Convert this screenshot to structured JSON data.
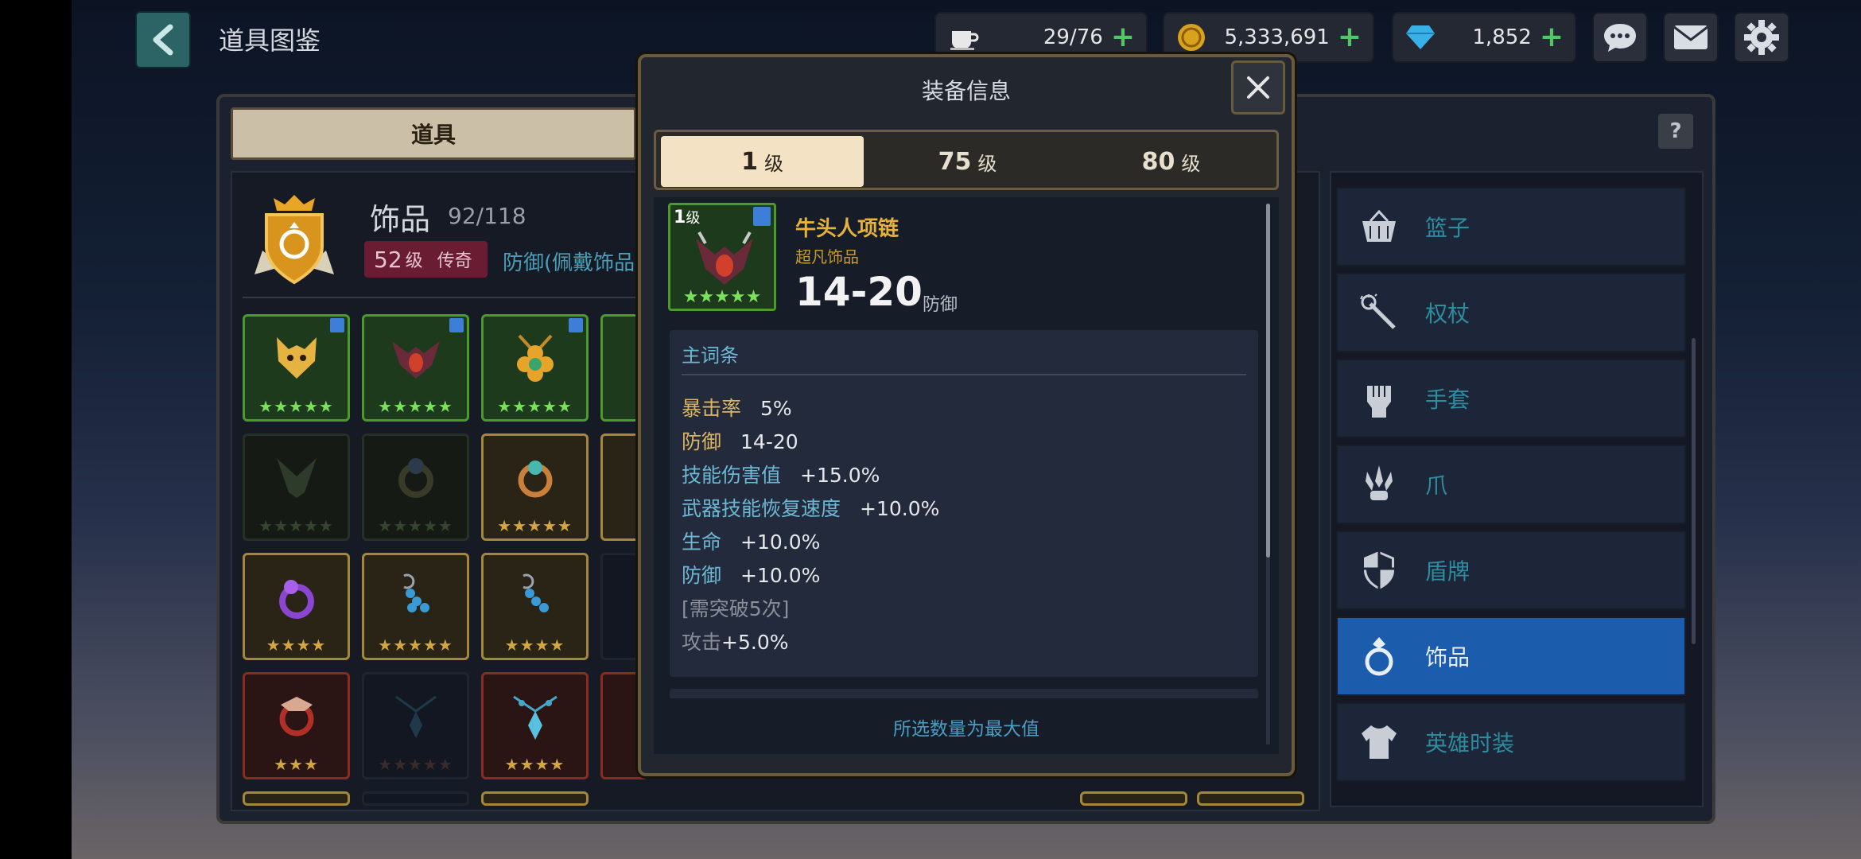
{
  "header": {
    "title": "道具图鉴",
    "stamina": "29/76",
    "gold": "5,333,691",
    "gems": "1,852"
  },
  "left_panel": {
    "tab_label": "道具",
    "category": {
      "name": "饰品",
      "count": "92/118",
      "level_value": "52",
      "level_unit": "级",
      "rank": "传奇",
      "desc": "防御(佩戴饰品"
    },
    "grid_star_rows": [
      "★★★★★",
      "★★★★★",
      "★★★★",
      "★★★"
    ]
  },
  "right_panel": {
    "help_label": "?",
    "categories": [
      {
        "label": "篮子",
        "icon": "basket-icon"
      },
      {
        "label": "权杖",
        "icon": "staff-icon"
      },
      {
        "label": "手套",
        "icon": "glove-icon"
      },
      {
        "label": "爪",
        "icon": "claw-icon"
      },
      {
        "label": "盾牌",
        "icon": "shield-icon"
      },
      {
        "label": "饰品",
        "icon": "ring-icon",
        "active": true
      },
      {
        "label": "英雄时装",
        "icon": "costume-icon"
      }
    ]
  },
  "modal": {
    "title": "装备信息",
    "tabs": [
      {
        "value": "1",
        "unit": "级",
        "active": true
      },
      {
        "value": "75",
        "unit": "级"
      },
      {
        "value": "80",
        "unit": "级"
      }
    ],
    "item": {
      "level_value": "1",
      "level_unit": "级",
      "stars": "★★★★★",
      "name": "牛头人项链",
      "rarity": "超凡饰品",
      "range": "14-20",
      "range_unit": "防御"
    },
    "main_stats": {
      "title": "主词条",
      "rows": [
        {
          "key": "暴击率",
          "value": "5%"
        },
        {
          "key": "防御",
          "value": "14-20"
        },
        {
          "key": "技能伤害值",
          "value": "+15.0%"
        },
        {
          "key": "武器技能恢复速度",
          "value": "+10.0%"
        },
        {
          "key": "生命",
          "value": "+10.0%"
        },
        {
          "key": "防御",
          "value": "+10.0%"
        },
        {
          "key": "[需突破5次]",
          "value": ""
        },
        {
          "key": "攻击",
          "value": "+5.0%"
        }
      ]
    },
    "footer": "所选数量为最大值"
  },
  "colors": {
    "accent_gold": "#e7b23a",
    "stat_blue": "#6cb8d4",
    "active_blue": "#1b5cad",
    "green": "#5ee25a"
  }
}
